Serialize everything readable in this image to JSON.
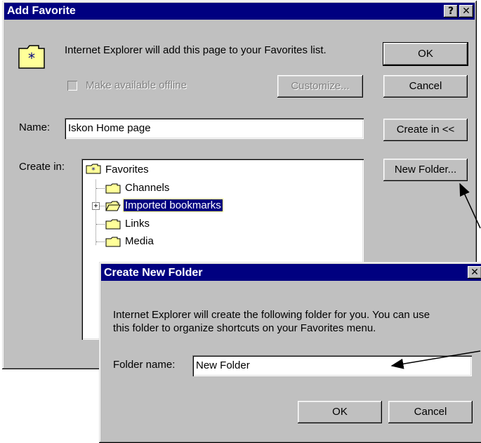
{
  "add_favorite": {
    "title": "Add Favorite",
    "help_glyph": "?",
    "close_glyph": "✕",
    "info_text": "Internet Explorer will add this page to your Favorites list.",
    "offline_checkbox_label": "Make available offline",
    "offline_checked": false,
    "customize_label": "Customize...",
    "ok_label": "OK",
    "cancel_label": "Cancel",
    "name_label": "Name:",
    "name_value": "Iskon Home page",
    "create_in_toggle_label": "Create in <<",
    "create_in_label": "Create in:",
    "new_folder_label": "New Folder...",
    "tree": {
      "root": "Favorites",
      "items": [
        "Channels",
        "Imported bookmarks",
        "Links",
        "Media"
      ],
      "selected": "Imported bookmarks",
      "expand_glyph": "+"
    }
  },
  "create_folder": {
    "title": "Create New Folder",
    "close_glyph": "✕",
    "info_line1": "Internet Explorer will create the following folder for you. You can use",
    "info_line2": "this folder to organize shortcuts on your Favorites menu.",
    "folder_name_label": "Folder name:",
    "folder_name_value": "New Folder",
    "ok_label": "OK",
    "cancel_label": "Cancel"
  },
  "colors": {
    "titlebar": "#000080",
    "face": "#c0c0c0",
    "folder_yellow": "#ffff99"
  }
}
